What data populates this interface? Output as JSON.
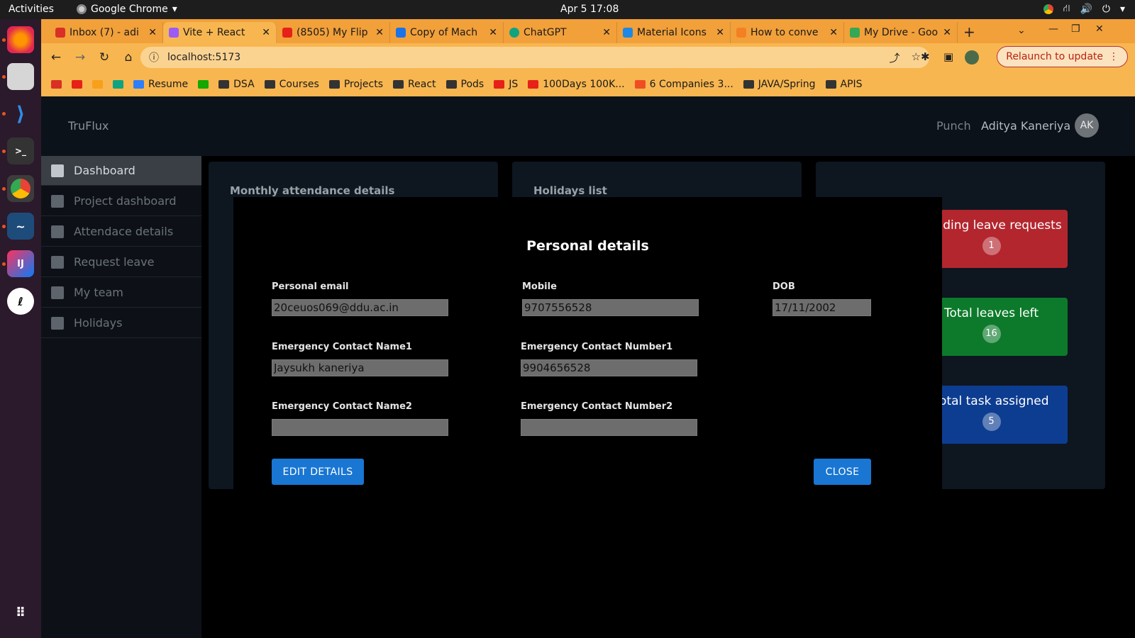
{
  "os": {
    "activities": "Activities",
    "app_name": "Google Chrome",
    "clock": "Apr 5  17:08"
  },
  "browser": {
    "tabs": [
      {
        "label": "Inbox (7) - adi",
        "color": "#d93025"
      },
      {
        "label": "Vite + React",
        "color": "#9b5cf6"
      },
      {
        "label": "(8505) My Flip",
        "color": "#e62117"
      },
      {
        "label": "Copy of Mach",
        "color": "#1a73e8"
      },
      {
        "label": "ChatGPT",
        "color": "#10a37f"
      },
      {
        "label": "Material Icons",
        "color": "#1e88e5"
      },
      {
        "label": "How to conve",
        "color": "#f48024"
      },
      {
        "label": "My Drive - Goo",
        "color": "#34a853"
      }
    ],
    "url": "localhost:5173",
    "relaunch": "Relaunch to update",
    "bookmarks": [
      {
        "label": "",
        "type": "gmail"
      },
      {
        "label": "",
        "type": "youtube"
      },
      {
        "label": "",
        "type": "leetcode"
      },
      {
        "label": "",
        "type": "chatgpt"
      },
      {
        "label": "Resume",
        "type": "notion"
      },
      {
        "label": "",
        "type": "upwork"
      },
      {
        "label": "DSA",
        "type": "folder"
      },
      {
        "label": "Courses",
        "type": "folder"
      },
      {
        "label": "Projects",
        "type": "folder"
      },
      {
        "label": "React",
        "type": "folder"
      },
      {
        "label": "Pods",
        "type": "folder"
      },
      {
        "label": "JS",
        "type": "youtube"
      },
      {
        "label": "100Days 100K...",
        "type": "youtube"
      },
      {
        "label": "6 Companies 3...",
        "type": "site"
      },
      {
        "label": "JAVA/Spring",
        "type": "folder"
      },
      {
        "label": "APIS",
        "type": "folder"
      }
    ]
  },
  "app": {
    "brand": "TruFlux",
    "punch": "Punch",
    "user_name": "Aditya Kaneriya",
    "avatar": "AK",
    "sidebar": [
      {
        "label": "Dashboard",
        "active": true
      },
      {
        "label": "Project dashboard",
        "active": false
      },
      {
        "label": "Attendace details",
        "active": false
      },
      {
        "label": "Request leave",
        "active": false
      },
      {
        "label": "My team",
        "active": false
      },
      {
        "label": "Holidays",
        "active": false
      }
    ],
    "cards": {
      "attendance_title": "Monthly attendance details",
      "holidays_title": "Holidays list"
    },
    "stats": [
      {
        "label": "Pending leave requests",
        "count": "1",
        "color": "#b3262e"
      },
      {
        "label": "Total leaves left",
        "count": "16",
        "color": "#0c7a2a"
      },
      {
        "label": "Total task assigned",
        "count": "5",
        "color": "#0d3d91"
      }
    ]
  },
  "modal": {
    "title": "Personal details",
    "personal_email_label": "Personal email",
    "personal_email": "20ceuos069@ddu.ac.in",
    "mobile_label": "Mobile",
    "mobile": "9707556528",
    "dob_label": "DOB",
    "dob": "17/11/2002",
    "ec_name1_label": "Emergency Contact Name1",
    "ec_name1": "Jaysukh kaneriya",
    "ec_number1_label": "Emergency Contact Number1",
    "ec_number1": "9904656528",
    "ec_name2_label": "Emergency Contact Name2",
    "ec_name2": "",
    "ec_number2_label": "Emergency Contact Number2",
    "ec_number2": "",
    "edit_button": "EDIT DETAILS",
    "close_button": "CLOSE"
  }
}
